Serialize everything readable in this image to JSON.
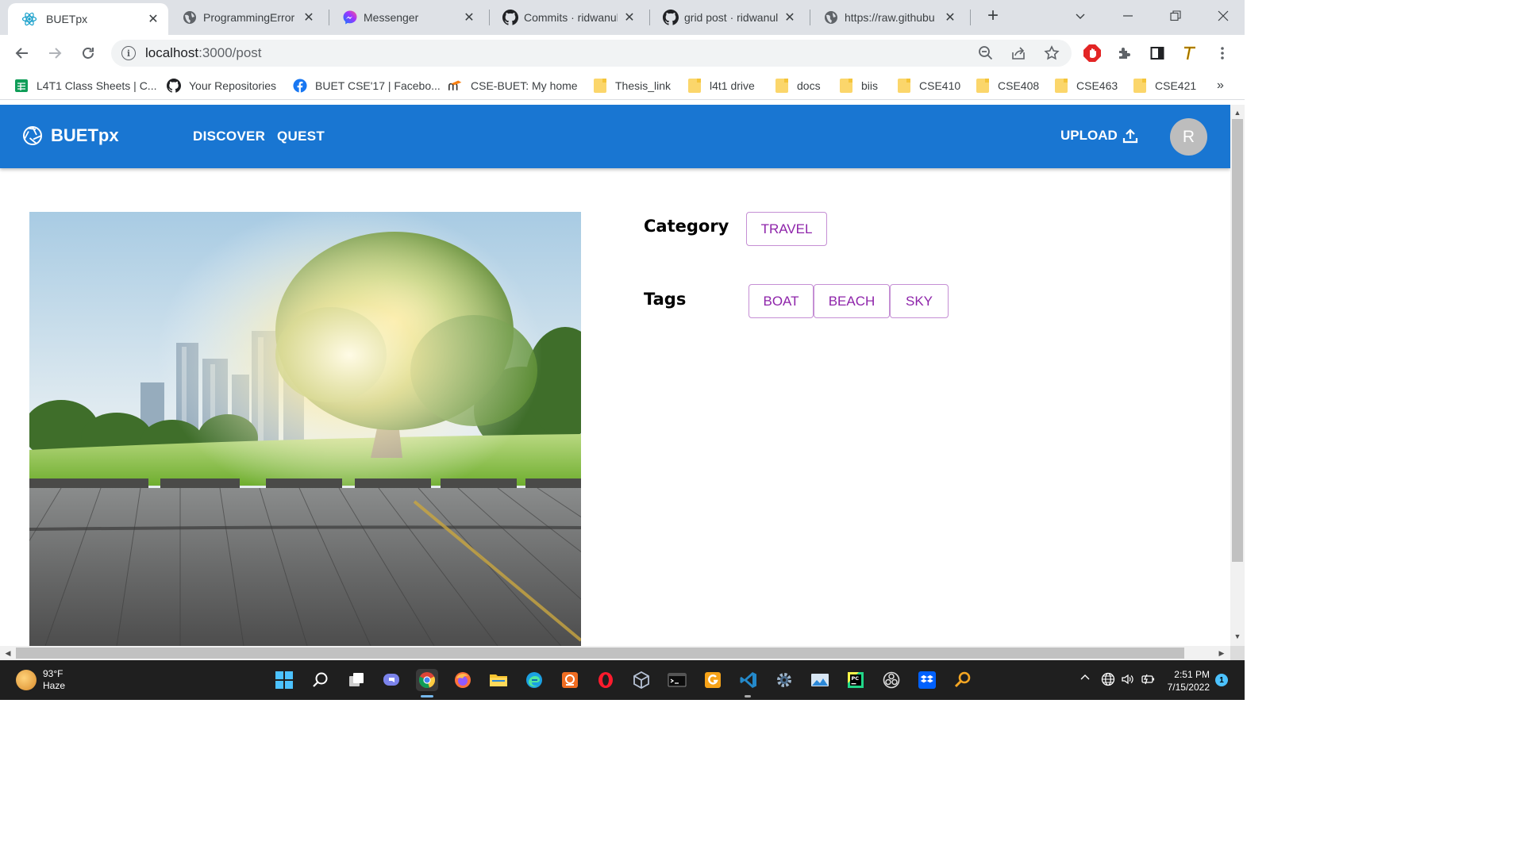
{
  "browser": {
    "tabs": [
      {
        "label": "BUETpx",
        "active": true
      },
      {
        "label": "ProgrammingError"
      },
      {
        "label": "Messenger"
      },
      {
        "label": "Commits · ridwanul"
      },
      {
        "label": "grid post · ridwanul"
      },
      {
        "label": "https://raw.githubu"
      }
    ],
    "new_tab": "+",
    "url_host": "localhost",
    "url_rest": ":3000/post",
    "bookmarks": [
      "L4T1 Class Sheets | C...",
      "Your Repositories",
      "BUET CSE'17 | Facebo...",
      "CSE-BUET: My home",
      "Thesis_link",
      "l4t1 drive",
      "docs",
      "biis",
      "CSE410",
      "CSE408",
      "CSE463",
      "CSE421"
    ],
    "bookmarks_more": "»"
  },
  "app": {
    "brand": "BUETpx",
    "nav": [
      "DISCOVER",
      "QUEST"
    ],
    "upload_label": "UPLOAD",
    "avatar_initial": "R",
    "colors": {
      "appbar": "#1976d2",
      "chip_text": "#8e24aa",
      "chip_border": "#c58fd4"
    }
  },
  "post": {
    "category_label": "Category",
    "category": "TRAVEL",
    "tags_label": "Tags",
    "tags": [
      "BOAT",
      "BEACH",
      "SKY"
    ]
  },
  "taskbar": {
    "weather_temp": "93°F",
    "weather_desc": "Haze",
    "time": "2:51 PM",
    "date": "7/15/2022",
    "notification_count": "1"
  }
}
